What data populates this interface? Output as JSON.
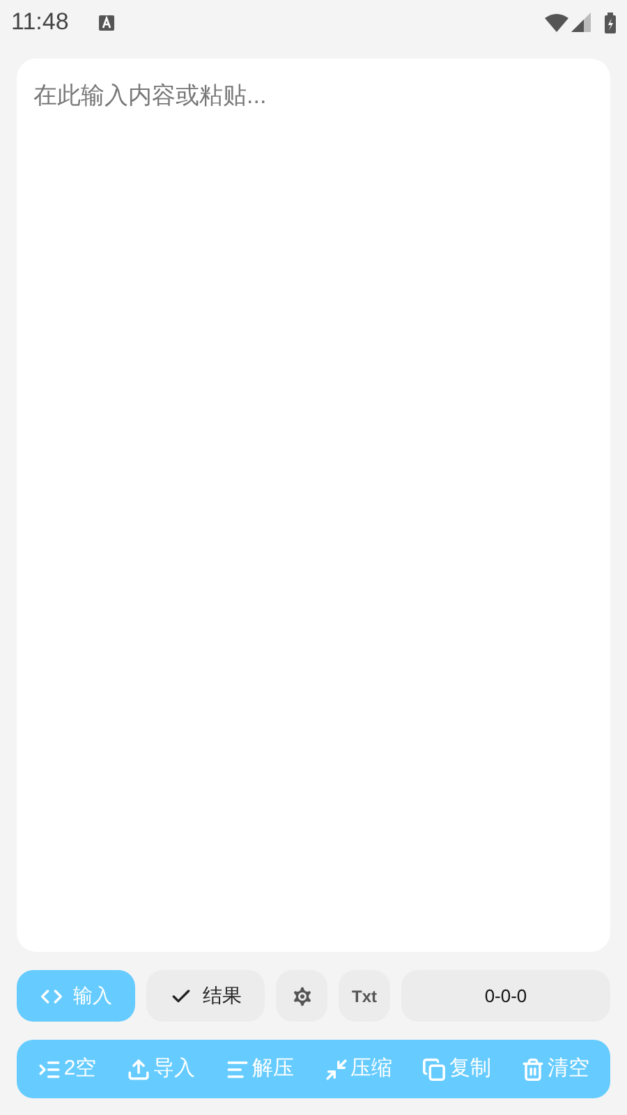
{
  "status_bar": {
    "time": "11:48"
  },
  "editor": {
    "placeholder": "在此输入内容或粘贴..."
  },
  "modes": [
    {
      "kind": "code",
      "label": "输入",
      "selected": true
    },
    {
      "kind": "check",
      "label": "结果",
      "selected": false
    }
  ],
  "format_button": {
    "label": "Txt"
  },
  "counter": "0-0-0",
  "actions": [
    {
      "kind": "indent",
      "label": "2空"
    },
    {
      "kind": "upload",
      "label": "导入"
    },
    {
      "kind": "lines",
      "label": "解压"
    },
    {
      "kind": "compress",
      "label": "压缩"
    },
    {
      "kind": "copy",
      "label": "复制"
    },
    {
      "kind": "trash",
      "label": "清空"
    }
  ]
}
